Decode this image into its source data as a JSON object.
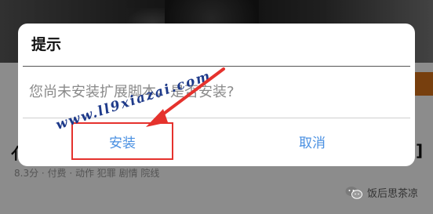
{
  "background": {
    "title_left": "亻",
    "title_right": "]",
    "meta": "8.3分 · 付费 · 动作 犯罪 剧情 院线"
  },
  "dialog": {
    "title": "提示",
    "message": "您尚未安装扩展脚本，是否安装?",
    "install_label": "安装",
    "cancel_label": "取消"
  },
  "annotation": {
    "watermark": "www.ll9xiazai.com",
    "arrow_color": "#e5322d",
    "highlight_color": "#e5322d"
  },
  "badge": {
    "icon": "wechat-icon",
    "text": "饭后思茶凉"
  },
  "colors": {
    "accent": "#4a90e2",
    "annotation_red": "#e5322d",
    "watermark_blue": "#1e3a8a"
  }
}
